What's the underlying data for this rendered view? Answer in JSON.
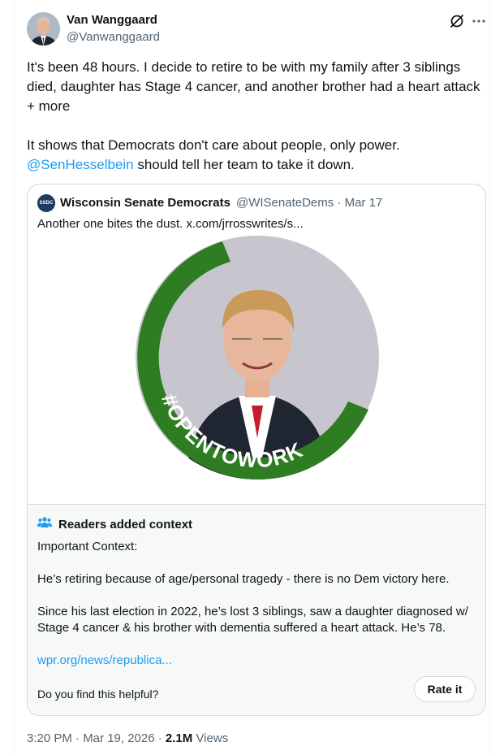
{
  "author": {
    "name": "Van Wanggaard",
    "handle": "@Vanwanggaard"
  },
  "tweet": {
    "line1": "It's been 48 hours. I decide to retire to be with my family after 3 siblings died, daughter has Stage 4 cancer, and another brother had a heart attack + more",
    "line2_pre": "It shows that Democrats don't care about people, only power.",
    "mention": "@SenHesselbein",
    "line2_post": " should tell her team to take it down."
  },
  "quote": {
    "avatar_text": "SSDC",
    "name": "Wisconsin Senate Democrats",
    "handle_date": "@WISenateDems · Mar 17",
    "text": "Another one bites the dust.  x.com/jrrosswrites/s...",
    "badge_text": "#OPENTOWORK"
  },
  "context": {
    "title": "Readers added context",
    "p1": "Important Context:",
    "p2": "He’s retiring because of age/personal tragedy - there is no Dem victory here.",
    "p3": "Since his last election in 2022,  he’s lost 3 siblings, saw a daughter diagnosed w/ Stage 4 cancer & his brother with dementia suffered a heart attack. He’s 78.",
    "link": "wpr.org/news/republica...",
    "question": "Do you find this helpful?",
    "rate_label": "Rate it"
  },
  "meta": {
    "time": "3:20 PM · Mar 19, 2026 · ",
    "views_count": "2.1M",
    "views_label": " Views"
  },
  "colors": {
    "link": "#1d9bf0",
    "badge_green": "#2e7d22"
  }
}
